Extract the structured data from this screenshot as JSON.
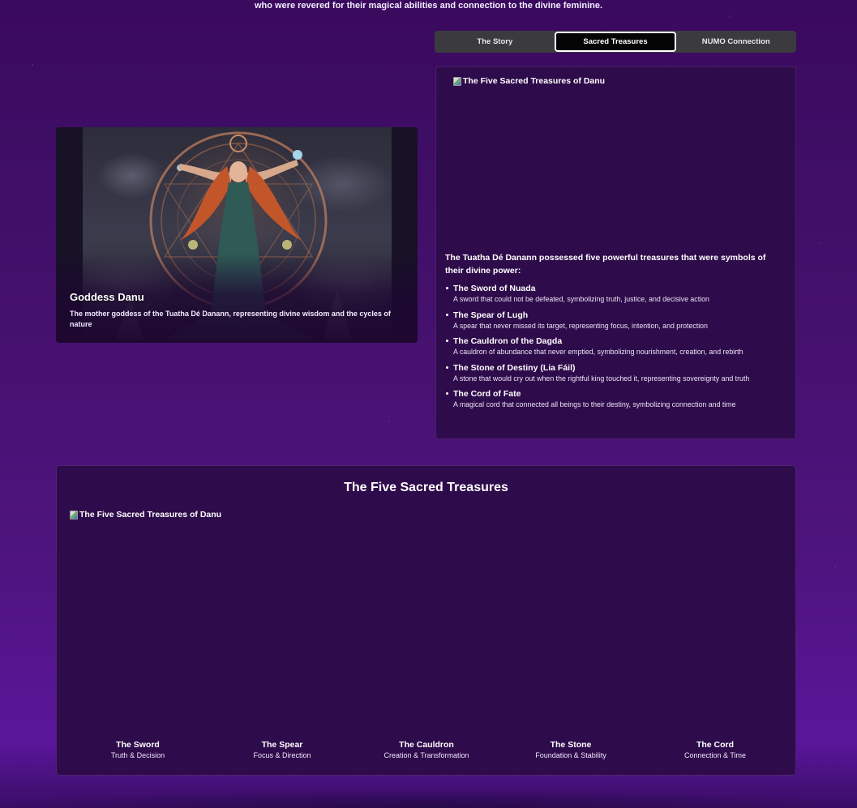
{
  "intro": {
    "text": "who were revered for their magical abilities and connection to the divine feminine."
  },
  "tabs": [
    {
      "label": "The Story",
      "active": false
    },
    {
      "label": "Sacred Treasures",
      "active": true
    },
    {
      "label": "NUMO Connection",
      "active": false
    }
  ],
  "goddess": {
    "title": "Goddess Danu",
    "description": "The mother goddess of the Tuatha Dé Danann, representing divine wisdom and the cycles of nature"
  },
  "treasures_panel": {
    "image_alt": "The Five Sacred Treasures of Danu",
    "intro": "The Tuatha Dé Danann possessed five powerful treasures that were symbols of their divine power:",
    "items": [
      {
        "name": "The Sword of Nuada",
        "desc": "A sword that could not be defeated, symbolizing truth, justice, and decisive action"
      },
      {
        "name": "The Spear of Lugh",
        "desc": "A spear that never missed its target, representing focus, intention, and protection"
      },
      {
        "name": "The Cauldron of the Dagda",
        "desc": "A cauldron of abundance that never emptied, symbolizing nourishment, creation, and rebirth"
      },
      {
        "name": "The Stone of Destiny (Lia Fáil)",
        "desc": "A stone that would cry out when the rightful king touched it, representing sovereignty and truth"
      },
      {
        "name": "The Cord of Fate",
        "desc": "A magical cord that connected all beings to their destiny, symbolizing connection and time"
      }
    ]
  },
  "sacred_section": {
    "title": "The Five Sacred Treasures",
    "image_alt": "The Five Sacred Treasures of Danu",
    "labels": [
      {
        "name": "The Sword",
        "sub": "Truth & Decision"
      },
      {
        "name": "The Spear",
        "sub": "Focus & Direction"
      },
      {
        "name": "The Cauldron",
        "sub": "Creation & Transformation"
      },
      {
        "name": "The Stone",
        "sub": "Foundation & Stability"
      },
      {
        "name": "The Cord",
        "sub": "Connection & Time"
      }
    ]
  },
  "colors": {
    "background": "#43106b",
    "panel": "#2e0b4a",
    "tab_bar": "#3b3b3f",
    "tab_active": "#050505"
  }
}
